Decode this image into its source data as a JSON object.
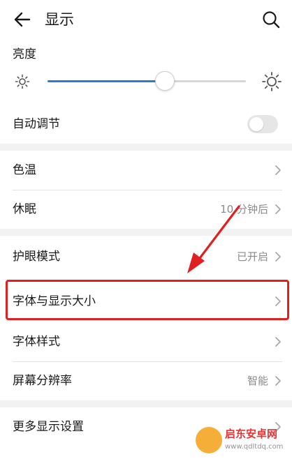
{
  "header": {
    "title": "显示"
  },
  "brightness": {
    "label": "亮度",
    "level_fraction": 0.59
  },
  "auto_adjust": {
    "label": "自动调节",
    "enabled": false
  },
  "group2": [
    {
      "label": "色温",
      "value": ""
    },
    {
      "label": "休眠",
      "value": "10 分钟后"
    }
  ],
  "group3": [
    {
      "label": "护眼模式",
      "value": "已开启"
    },
    {
      "label": "字体与显示大小",
      "value": ""
    },
    {
      "label": "字体样式",
      "value": ""
    },
    {
      "label": "屏幕分辨率",
      "value": "智能"
    }
  ],
  "group4": [
    {
      "label": "更多显示设置",
      "value": ""
    }
  ],
  "watermark": {
    "title": "启东安卓网",
    "url": "www.qdltdq.com"
  },
  "colors": {
    "accent": "#2a7ad8",
    "highlight": "#e02020",
    "background": "#f2f2f2"
  },
  "icons": [
    "back-arrow-icon",
    "search-icon",
    "sun-small-icon",
    "sun-large-icon",
    "chevron-right-icon"
  ]
}
